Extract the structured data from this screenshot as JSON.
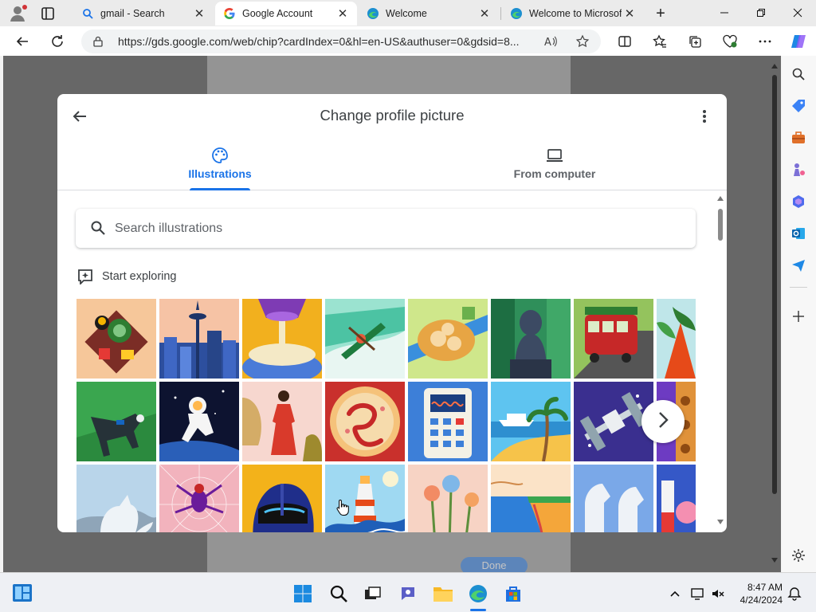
{
  "browser": {
    "tabs": [
      {
        "title": "gmail - Search",
        "favicon": "search-icon",
        "active": false
      },
      {
        "title": "Google Account",
        "favicon": "google-g-icon",
        "active": true
      },
      {
        "title": "Welcome",
        "favicon": "edge-icon",
        "active": false
      },
      {
        "title": "Welcome to Microsoft",
        "favicon": "edge-icon",
        "active": false
      }
    ],
    "url": "https://gds.google.com/web/chip?cardIndex=0&hl=en-US&authuser=0&gdsid=8...",
    "colors": {
      "accent": "#1a73e8",
      "frame": "#ebebeb"
    }
  },
  "dialog": {
    "title": "Change profile picture",
    "tabs": [
      {
        "label": "Illustrations",
        "icon": "palette-icon",
        "selected": true
      },
      {
        "label": "From computer",
        "icon": "laptop-icon",
        "selected": false
      }
    ],
    "search_placeholder": "Search illustrations",
    "section_label": "Start exploring",
    "illustrations": [
      "food-platter",
      "city-skyline",
      "cream-pour",
      "kayak-rapids",
      "pastry-plate",
      "stone-statue",
      "trolley-car",
      "tropical-leaves",
      "dog-running",
      "astronaut",
      "woman-red-dress",
      "pizza-snake",
      "calculator",
      "beach-cruise",
      "space-station",
      "orange-pattern",
      "arctic-fox",
      "spider-web",
      "motorcycle-helmet",
      "lighthouse-waves",
      "garden-flowers",
      "coastal-cliff",
      "white-horse-statue",
      "science-brain"
    ]
  },
  "page_behind": {
    "done_label": "Done"
  },
  "taskbar": {
    "time": "8:47 AM",
    "date": "4/24/2024"
  }
}
